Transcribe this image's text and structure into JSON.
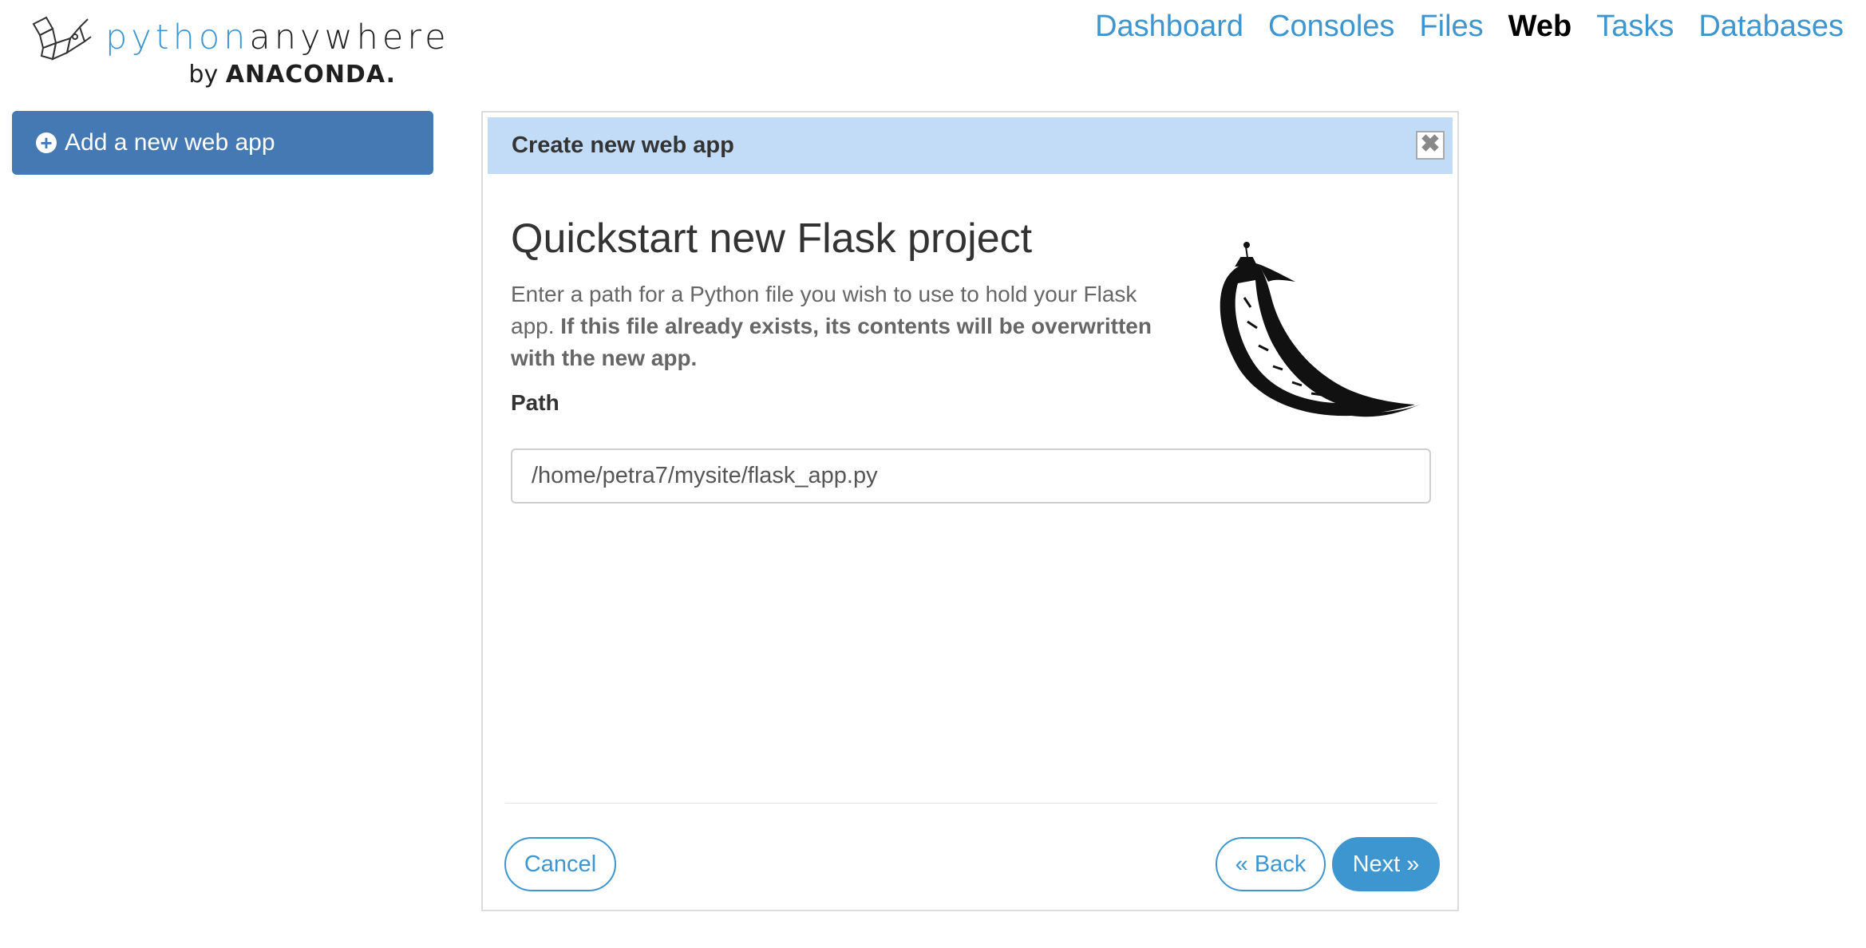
{
  "brand": {
    "name_python": "python",
    "name_anywhere": "anywhere",
    "by_text": "by",
    "company": "ANACONDA."
  },
  "nav": {
    "items": [
      {
        "label": "Dashboard",
        "active": false
      },
      {
        "label": "Consoles",
        "active": false
      },
      {
        "label": "Files",
        "active": false
      },
      {
        "label": "Web",
        "active": true
      },
      {
        "label": "Tasks",
        "active": false
      },
      {
        "label": "Databases",
        "active": false
      }
    ]
  },
  "sidebar": {
    "add_button_label": "Add a new web app",
    "add_icon": "plus-circle-icon"
  },
  "dialog": {
    "title": "Create new web app",
    "close_icon": "close-icon",
    "heading": "Quickstart new Flask project",
    "description_plain": "Enter a path for a Python file you wish to use to hold your Flask app. ",
    "description_bold": "If this file already exists, its contents will be overwritten with the new app.",
    "path_label": "Path",
    "path_value": "/home/petra7/mysite/flask_app.py",
    "image": "flask-horn-logo",
    "buttons": {
      "cancel": "Cancel",
      "back": "« Back",
      "next": "Next »"
    }
  },
  "colors": {
    "accent": "#3d96d0",
    "sidebar_button": "#4479b3",
    "dialog_header": "#c2dcf8"
  }
}
